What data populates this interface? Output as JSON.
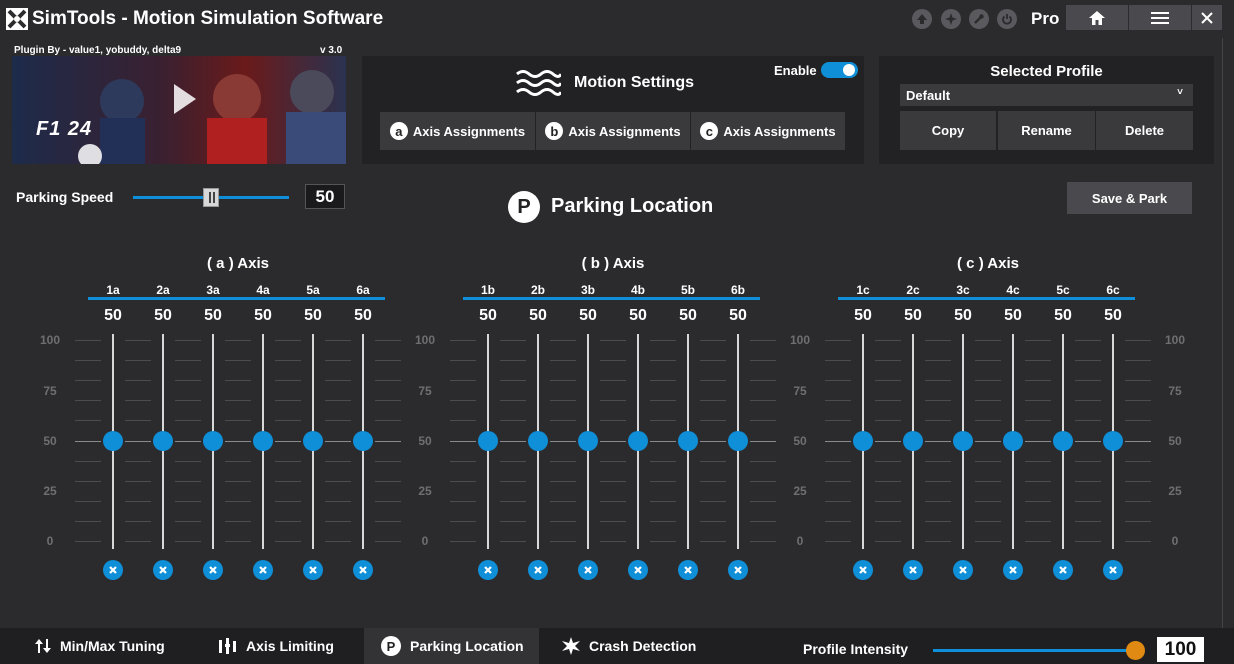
{
  "titlebar": {
    "app_title": "SimTools - Motion Simulation Software",
    "pro_label": "Pro",
    "icons": [
      "up-arrow-icon",
      "star-icon",
      "wrench-icon",
      "power-icon"
    ],
    "buttons": [
      "home-icon",
      "menu-icon",
      "close-icon"
    ]
  },
  "plugin": {
    "by": "Plugin By - value1, yobuddy, delta9",
    "version": "v 3.0",
    "banner_text": "F1 24"
  },
  "motion": {
    "title": "Motion Settings",
    "enable_label": "Enable",
    "enabled": true,
    "assignments": [
      {
        "badge": "a",
        "label": "Axis Assignments"
      },
      {
        "badge": "b",
        "label": "Axis Assignments"
      },
      {
        "badge": "c",
        "label": "Axis Assignments"
      }
    ]
  },
  "profile": {
    "title": "Selected Profile",
    "selected": "Default",
    "caret": "˅",
    "buttons": [
      "Copy",
      "Rename",
      "Delete"
    ]
  },
  "parking": {
    "speed_label": "Parking Speed",
    "speed_value": "50",
    "title": "Parking Location",
    "title_icon": "P",
    "save_button": "Save & Park"
  },
  "scale_ticks": [
    "100",
    "75",
    "50",
    "25",
    "0"
  ],
  "groups": [
    {
      "title": "( a ) Axis",
      "channels": [
        {
          "label": "1a",
          "value": "50"
        },
        {
          "label": "2a",
          "value": "50"
        },
        {
          "label": "3a",
          "value": "50"
        },
        {
          "label": "4a",
          "value": "50"
        },
        {
          "label": "5a",
          "value": "50"
        },
        {
          "label": "6a",
          "value": "50"
        }
      ]
    },
    {
      "title": "( b ) Axis",
      "channels": [
        {
          "label": "1b",
          "value": "50"
        },
        {
          "label": "2b",
          "value": "50"
        },
        {
          "label": "3b",
          "value": "50"
        },
        {
          "label": "4b",
          "value": "50"
        },
        {
          "label": "5b",
          "value": "50"
        },
        {
          "label": "6b",
          "value": "50"
        }
      ]
    },
    {
      "title": "( c ) Axis",
      "channels": [
        {
          "label": "1c",
          "value": "50"
        },
        {
          "label": "2c",
          "value": "50"
        },
        {
          "label": "3c",
          "value": "50"
        },
        {
          "label": "4c",
          "value": "50"
        },
        {
          "label": "5c",
          "value": "50"
        },
        {
          "label": "6c",
          "value": "50"
        }
      ]
    }
  ],
  "bottom_tabs": [
    {
      "label": "Min/Max Tuning",
      "icon": "updown-arrows-icon"
    },
    {
      "label": "Axis Limiting",
      "icon": "axis-limit-icon"
    },
    {
      "label": "Parking Location",
      "icon": "parking-icon",
      "active": true
    },
    {
      "label": "Crash Detection",
      "icon": "crash-icon"
    }
  ],
  "intensity": {
    "label": "Profile Intensity",
    "value": "100"
  },
  "colors": {
    "accent": "#0f8fd8",
    "background": "#2b2b2e",
    "panel": "#222224",
    "knob_orange": "#e08a14"
  }
}
